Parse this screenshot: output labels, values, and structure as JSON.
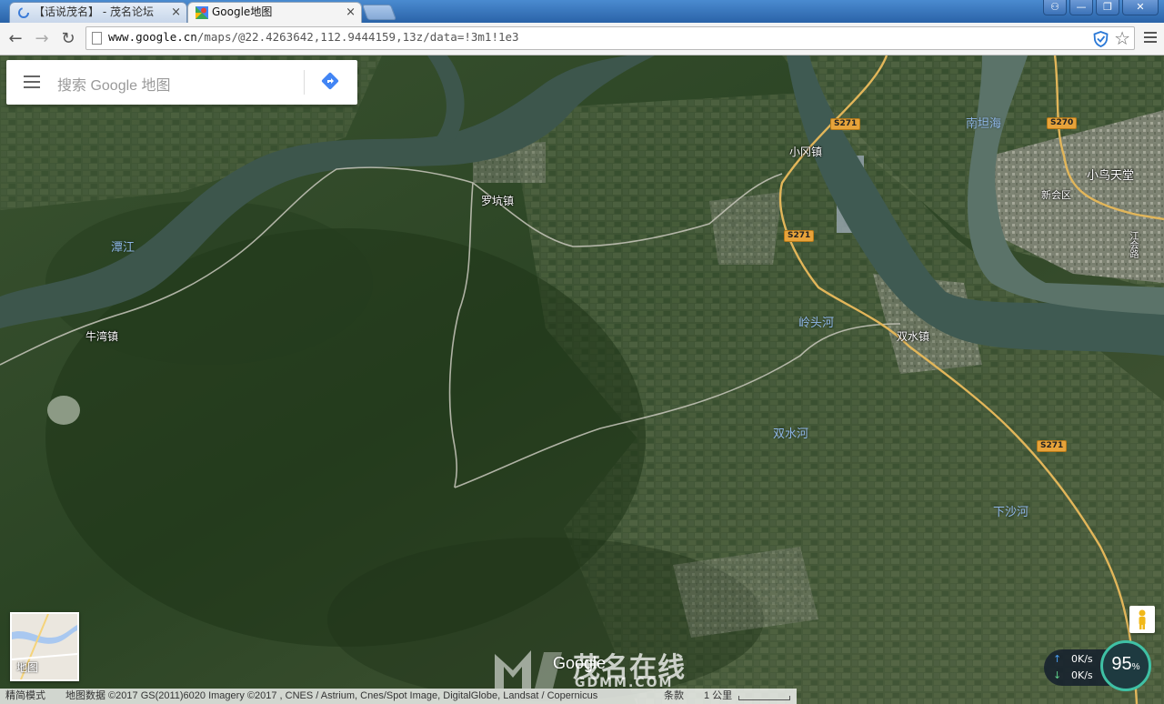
{
  "tabs": [
    {
      "title": "【话说茂名】 - 茂名论坛",
      "active": false,
      "close": "×"
    },
    {
      "title": "Google地图",
      "active": true,
      "close": "×"
    }
  ],
  "window_buttons": {
    "user": "⚇",
    "minimize": "—",
    "restore": "❐",
    "close": "✕"
  },
  "toolbar": {
    "back": "←",
    "forward": "→",
    "reload": "↻",
    "url_host": "www.google.cn",
    "url_path": "/maps/@22.4263642,112.9444159,13z/data=!3m1!1e3"
  },
  "search": {
    "placeholder": "搜索 Google 地图"
  },
  "map_labels": {
    "tanjiang": "潭江",
    "niuwan": "牛湾镇",
    "luokeng": "罗坑镇",
    "xiaogang": "小冈镇",
    "nantanhai": "南坦海",
    "xiaoniao": "小鸟天堂",
    "xinhuiqu": "新会区",
    "jiangjun": "江会路",
    "lingtouhe": "岭头河",
    "shuangshui": "双水镇",
    "shuangshuihe": "双水河",
    "xiashahe": "下沙河"
  },
  "road_shields": [
    "S271",
    "S271",
    "S271",
    "S270"
  ],
  "thumbnail": {
    "label": "地图"
  },
  "watermark": {
    "brand": "茂名在线",
    "site": "GDMM.COM",
    "google": "Google"
  },
  "net_monitor": {
    "up": "0K/s",
    "down": "0K/s",
    "value": "95",
    "unit": "%"
  },
  "attribution": {
    "mode": "精简模式",
    "data": "地图数据 ©2017 GS(2011)6020 Imagery ©2017 , CNES / Astrium, Cnes/Spot Image, DigitalGlobe, Landsat / Copernicus",
    "terms": "条款",
    "scale": "1 公里"
  },
  "colors": {
    "tabbar": "#2f6fb6",
    "river": "#3f5a52",
    "vegetation": "#2f4a28",
    "road_shield": "#e7a33a",
    "accent": "#4285f4"
  }
}
